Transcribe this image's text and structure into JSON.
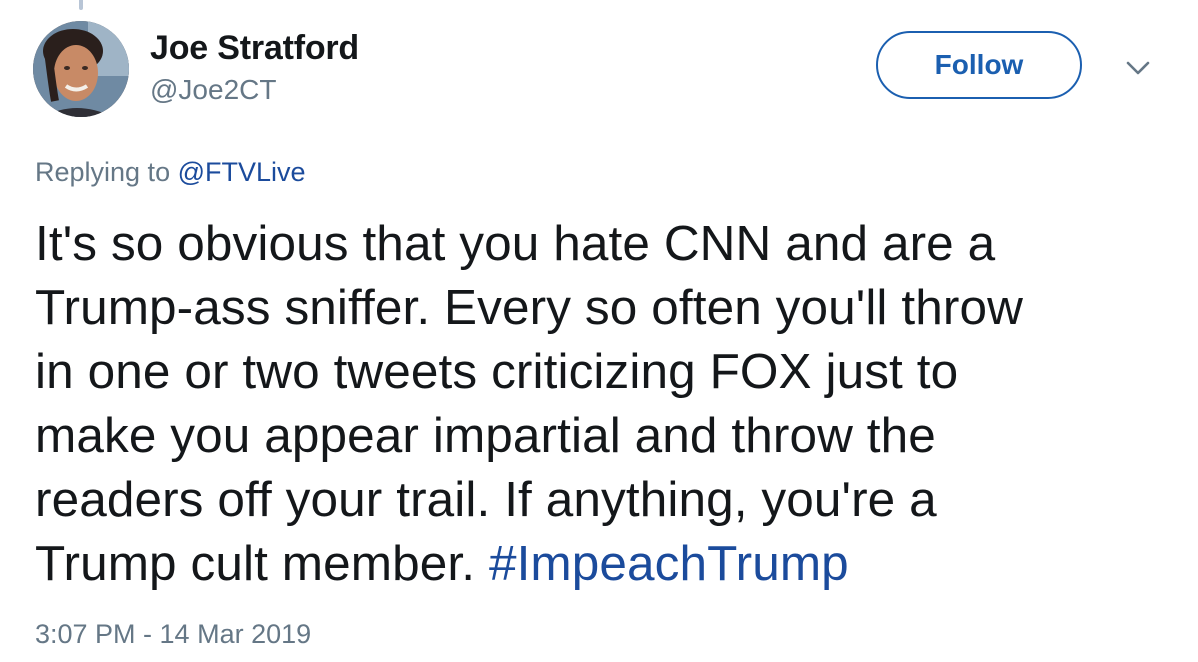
{
  "author": {
    "display_name": "Joe Stratford",
    "handle": "@Joe2CT"
  },
  "actions": {
    "follow_label": "Follow",
    "more_icon": "chevron-down-icon"
  },
  "reply": {
    "prefix": "Replying to",
    "mention": "@FTVLive"
  },
  "tweet": {
    "lines": [
      "It's so obvious that you hate CNN and are a",
      "Trump-ass sniffer. Every so often you'll throw",
      "in one or two tweets criticizing FOX just to",
      "make you appear impartial and throw the",
      "readers off your trail. If anything, you're a"
    ],
    "last_line_text": "Trump cult member.",
    "hashtag": "#ImpeachTrump"
  },
  "timestamp": "3:07 PM - 14 Mar 2019",
  "colors": {
    "link": "#1b4b9c",
    "follow_border": "#1b5fb0",
    "secondary_text": "#657786",
    "primary_text": "#14171a"
  }
}
